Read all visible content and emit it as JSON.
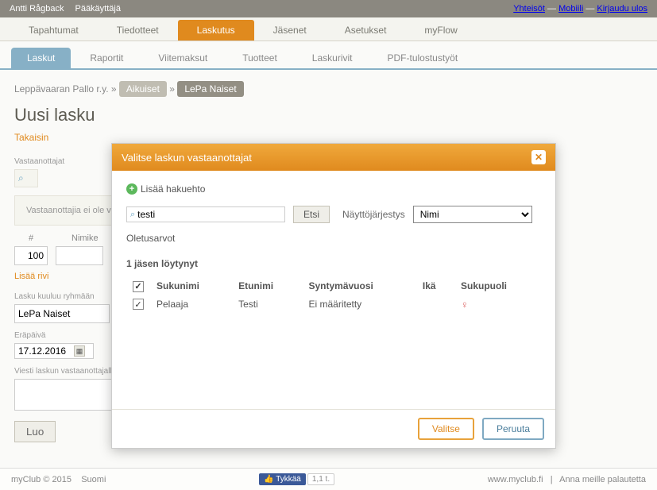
{
  "topbar": {
    "user": "Antti Rågback",
    "role": "Pääkäyttäjä",
    "links": {
      "communities": "Yhteisöt",
      "mobile": "Mobiili",
      "logout": "Kirjaudu ulos"
    }
  },
  "maintabs": [
    "Tapahtumat",
    "Tiedotteet",
    "Laskutus",
    "Jäsenet",
    "Asetukset",
    "myFlow"
  ],
  "subtabs": [
    "Laskut",
    "Raportit",
    "Viitemaksut",
    "Tuotteet",
    "Laskurivit",
    "PDF-tulostustyöt"
  ],
  "breadcrumb": {
    "org": "Leppävaaran Pallo r.y.",
    "sep": "»",
    "group1": "Aikuiset",
    "group2": "LePa Naiset"
  },
  "page": {
    "title": "Uusi lasku",
    "back": "Takaisin",
    "recipients_label": "Vastaanottajat",
    "no_recipients": "Vastaanottajia ei ole valittu",
    "row_headers": {
      "num": "#",
      "name": "Nimike"
    },
    "row_values": {
      "num": "100"
    },
    "add_row": "Lisää rivi",
    "group_label": "Lasku kuuluu ryhmään",
    "group_value": "LePa Naiset",
    "duedate_label": "Eräpäivä",
    "duedate_value": "17.12.2016",
    "msg_label": "Viesti laskun vastaanottajalle",
    "create": "Luo"
  },
  "modal": {
    "title": "Valitse laskun vastaanottajat",
    "add_filter": "Lisää hakuehto",
    "search_value": "testi",
    "search_btn": "Etsi",
    "sort_label": "Näyttöjärjestys",
    "sort_value": "Nimi",
    "defaults": "Oletusarvot",
    "found": "1 jäsen löytynyt",
    "columns": {
      "lastname": "Sukunimi",
      "firstname": "Etunimi",
      "birthyear": "Syntymävuosi",
      "age": "Ikä",
      "gender": "Sukupuoli"
    },
    "rows": [
      {
        "lastname": "Pelaaja",
        "firstname": "Testi",
        "birthyear": "Ei määritetty",
        "age": "",
        "gender_icon": "♀"
      }
    ],
    "select": "Valitse",
    "cancel": "Peruuta"
  },
  "footer": {
    "copyright": "myClub © 2015",
    "lang": "Suomi",
    "like": "Tykkää",
    "like_count": "1,1 t.",
    "url": "www.myclub.fi",
    "feedback": "Anna meille palautetta"
  }
}
